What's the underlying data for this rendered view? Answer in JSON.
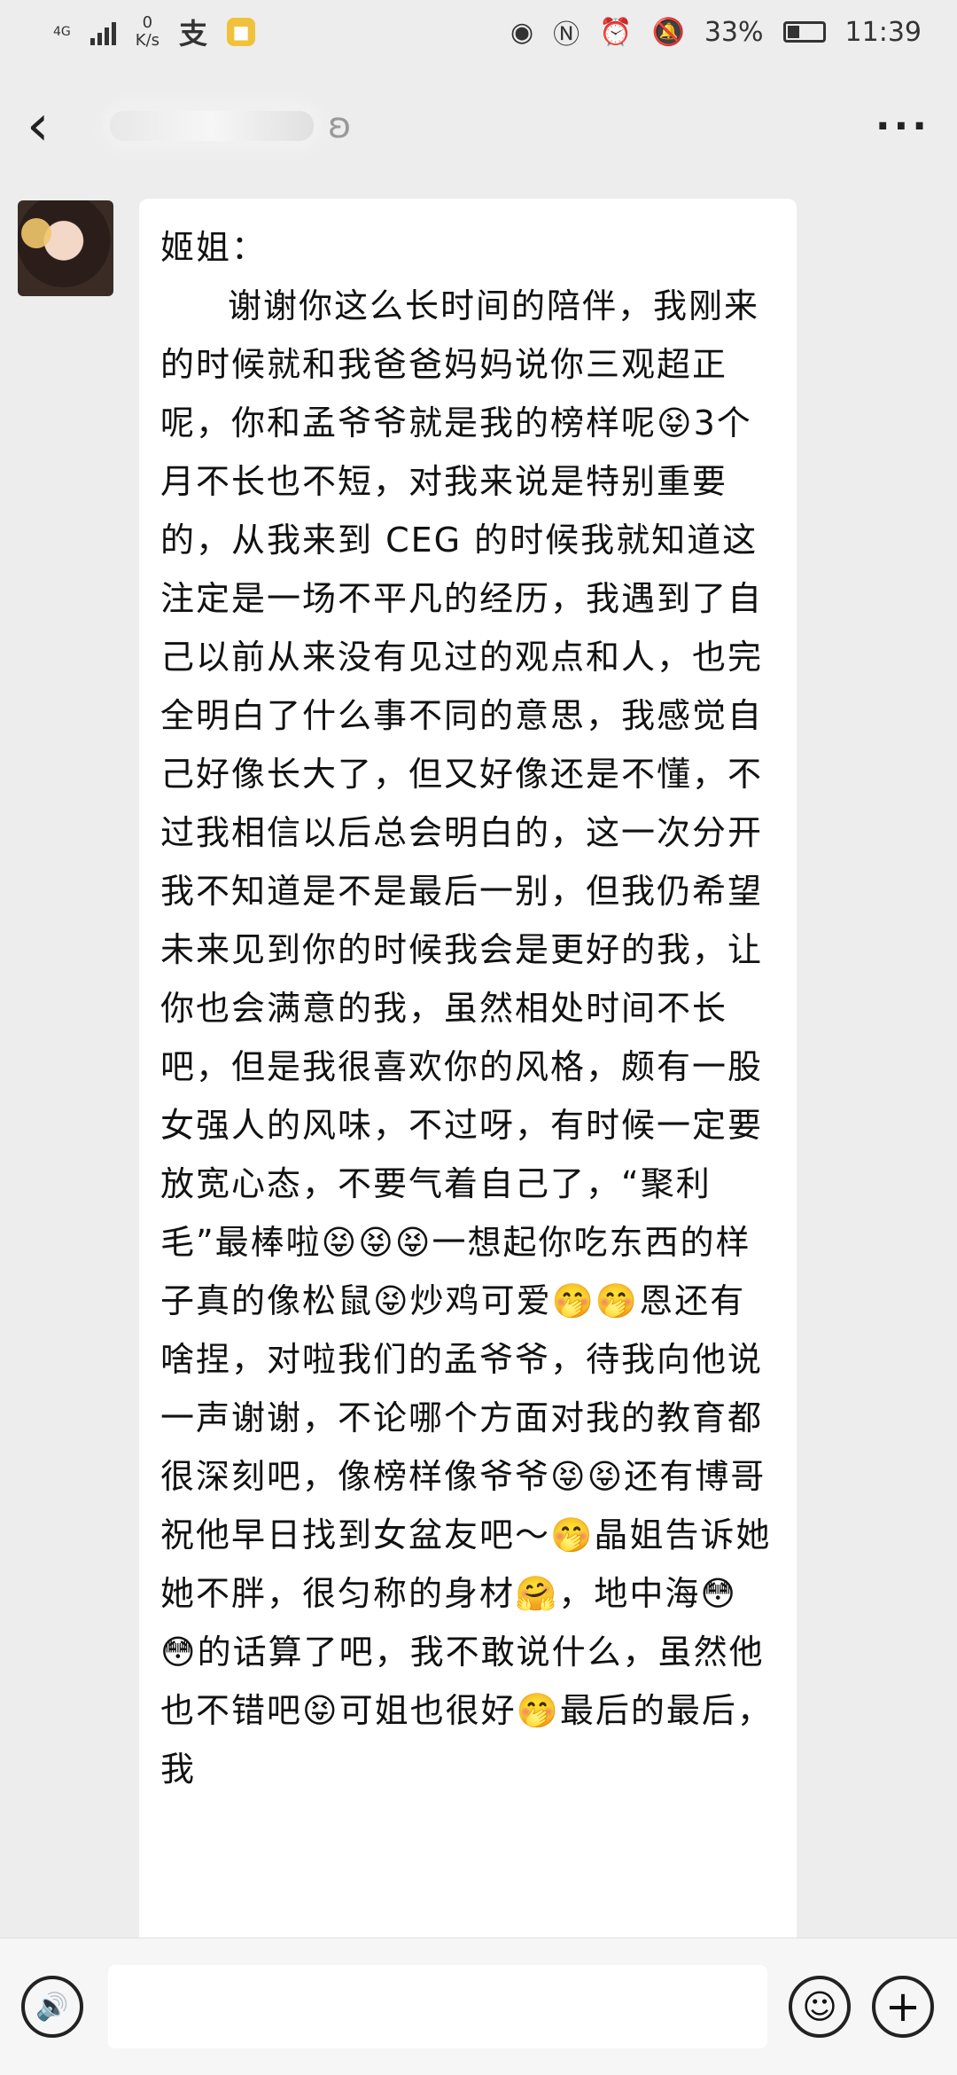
{
  "status_bar": {
    "network": "4G",
    "net_speed_value": "0",
    "net_speed_unit": "K/s",
    "app_icon_alipay": "支",
    "battery": "33%",
    "time": "11:39"
  },
  "header": {
    "back_icon": "‹",
    "more_icon": "···",
    "ear_icon": "ʚ"
  },
  "message": {
    "greeting": "姬姐：",
    "body": "谢谢你这么长时间的陪伴，我刚来的时候就和我爸爸妈妈说你三观超正呢，你和孟爷爷就是我的榜样呢😝3个月不长也不短，对我来说是特别重要的，从我来到 CEG 的时候我就知道这注定是一场不平凡的经历，我遇到了自己以前从来没有见过的观点和人，也完全明白了什么事不同的意思，我感觉自己好像长大了，但又好像还是不懂，不过我相信以后总会明白的，这一次分开我不知道是不是最后一别，但我仍希望未来见到你的时候我会是更好的我，让你也会满意的我，虽然相处时间不长吧，但是我很喜欢你的风格，颇有一股女强人的风味，不过呀，有时候一定要放宽心态，不要气着自己了，“聚利毛”最棒啦😝😝😝一想起你吃东西的样子真的像松鼠😝炒鸡可爱🤭🤭恩还有啥捏，对啦我们的孟爷爷，待我向他说一声谢谢，不论哪个方面对我的教育都很深刻吧，像榜样像爷爷😝😝还有博哥祝他早日找到女盆友吧～🤭晶姐告诉她她不胖，很匀称的身材🤗，地中海😳😳的话算了吧，我不敢说什么，虽然他也不错吧😝可姐也很好🤭最后的最后，我"
  },
  "input_bar": {
    "voice_icon": "🔊",
    "emoji_icon": "☺",
    "plus_icon": "+"
  }
}
